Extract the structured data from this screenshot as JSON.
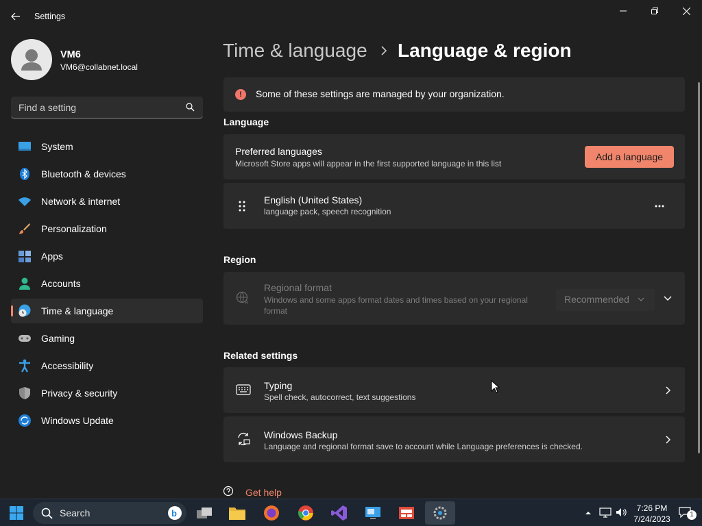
{
  "window": {
    "app_title": "Settings"
  },
  "profile": {
    "name": "VM6",
    "email": "VM6@collabnet.local"
  },
  "search": {
    "placeholder": "Find a setting"
  },
  "sidebar": {
    "items": [
      {
        "label": "System",
        "icon": "system-icon"
      },
      {
        "label": "Bluetooth & devices",
        "icon": "bluetooth-icon"
      },
      {
        "label": "Network & internet",
        "icon": "wifi-icon"
      },
      {
        "label": "Personalization",
        "icon": "brush-icon"
      },
      {
        "label": "Apps",
        "icon": "apps-icon"
      },
      {
        "label": "Accounts",
        "icon": "accounts-icon"
      },
      {
        "label": "Time & language",
        "icon": "time-language-icon",
        "selected": true
      },
      {
        "label": "Gaming",
        "icon": "gamepad-icon"
      },
      {
        "label": "Accessibility",
        "icon": "accessibility-icon"
      },
      {
        "label": "Privacy & security",
        "icon": "shield-icon"
      },
      {
        "label": "Windows Update",
        "icon": "windows-update-icon"
      }
    ]
  },
  "header": {
    "parent": "Time & language",
    "current": "Language & region"
  },
  "info_bar": {
    "text": "Some of these settings are managed by your organization."
  },
  "language": {
    "section_label": "Language",
    "preferred_title": "Preferred languages",
    "preferred_desc": "Microsoft Store apps will appear in the first supported language in this list",
    "add_button": "Add a language",
    "entries": [
      {
        "name": "English (United States)",
        "features": "language pack, speech recognition"
      }
    ]
  },
  "region": {
    "section_label": "Region",
    "format_title": "Regional format",
    "format_desc_line1": "Windows and some apps format dates and times based on your regional",
    "format_desc_line2": "format",
    "format_value": "Recommended"
  },
  "related": {
    "section_label": "Related settings",
    "items": [
      {
        "title": "Typing",
        "desc": "Spell check, autocorrect, text suggestions",
        "icon": "keyboard-icon"
      },
      {
        "title": "Windows Backup",
        "desc": "Language and regional format save to account while Language preferences is checked.",
        "icon": "backup-icon"
      }
    ]
  },
  "help": {
    "label": "Get help"
  },
  "taskbar": {
    "search_label": "Search",
    "time": "7:26 PM",
    "date": "7/24/2023",
    "notification_count": "1"
  },
  "colors": {
    "accent": "#f0856b",
    "background": "#202020",
    "card": "#2b2b2b",
    "taskbar": "#1c2530"
  }
}
